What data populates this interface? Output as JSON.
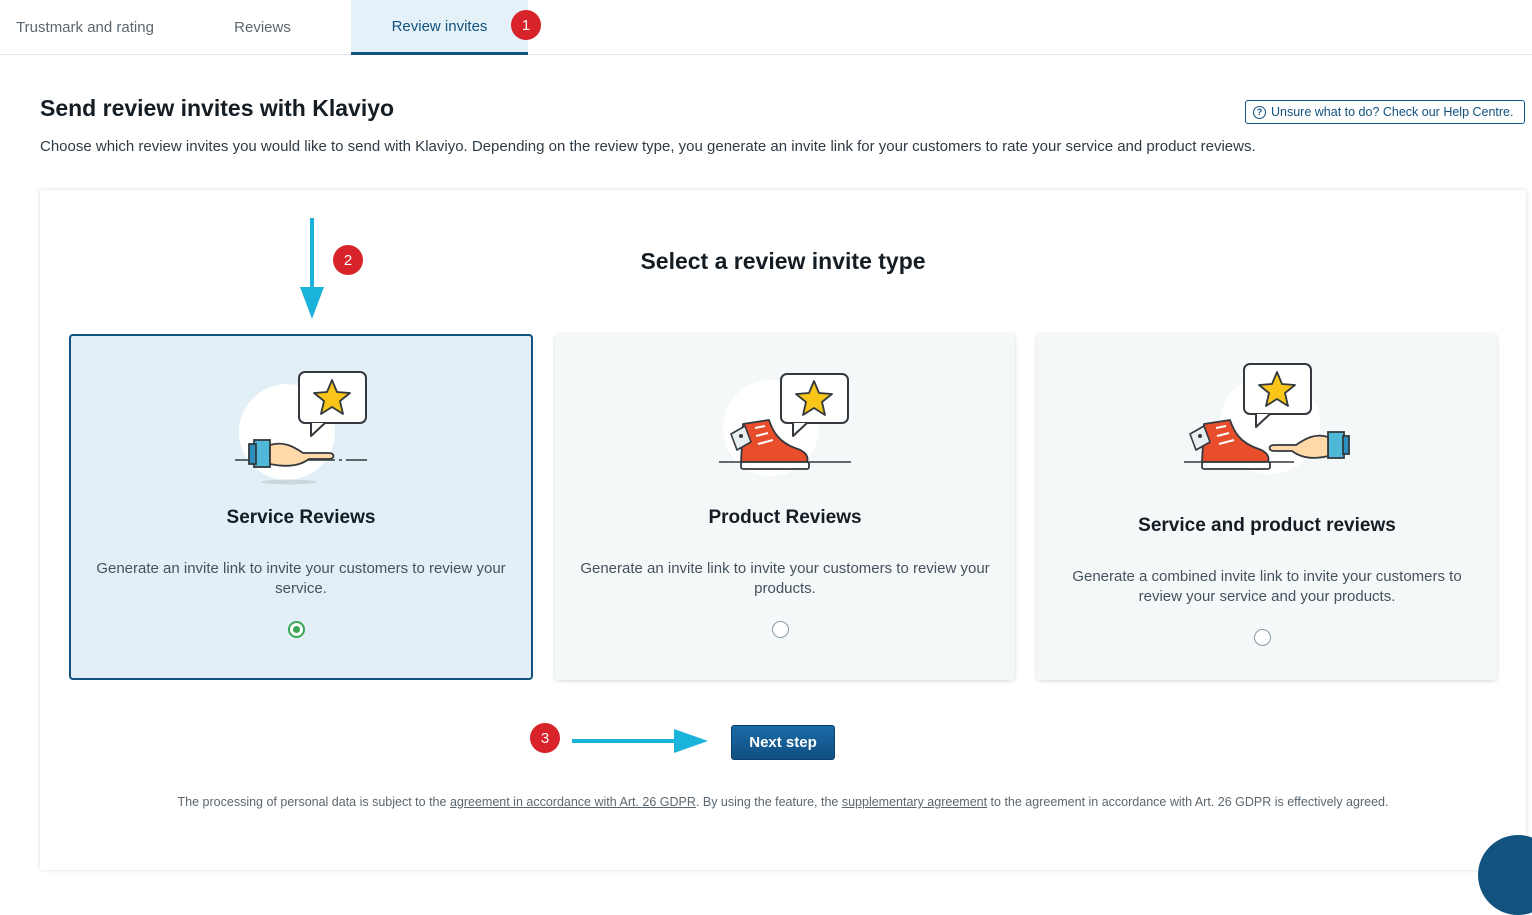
{
  "tabs": [
    {
      "label": "Trustmark and rating"
    },
    {
      "label": "Reviews"
    },
    {
      "label": "Review invites"
    }
  ],
  "annotations": {
    "badge1": "1",
    "badge2": "2",
    "badge3": "3"
  },
  "header": {
    "title": "Send review invites with Klaviyo",
    "help_label": "Unsure what to do? Check our Help Centre.",
    "description": "Choose which review invites you would like to send with Klaviyo. Depending on the review type, you generate an invite link for your customers to rate your service and product reviews."
  },
  "selector": {
    "title": "Select a review invite type",
    "options": [
      {
        "heading": "Service Reviews",
        "text": "Generate an invite link to invite your customers to review your service.",
        "selected": true
      },
      {
        "heading": "Product Reviews",
        "text": "Generate an invite link to invite your customers to review your products.",
        "selected": false
      },
      {
        "heading": "Service and product reviews",
        "text": "Generate a combined invite link to invite your customers to review your service and your products.",
        "selected": false
      }
    ]
  },
  "next_button": "Next step",
  "legal": {
    "part1": "The processing of personal data is subject to the ",
    "link1": "agreement in accordance with Art. 26 GDPR",
    "part2": ". By using the feature, the ",
    "link2": "supplementary agreement",
    "part3": " to the agreement in accordance with Art. 26 GDPR is effectively agreed."
  },
  "colors": {
    "brand": "#11527f",
    "badge": "#d8232a",
    "arrow": "#1ab3d9",
    "selected_radio": "#3aa655",
    "sneaker": "#e84d2c"
  }
}
